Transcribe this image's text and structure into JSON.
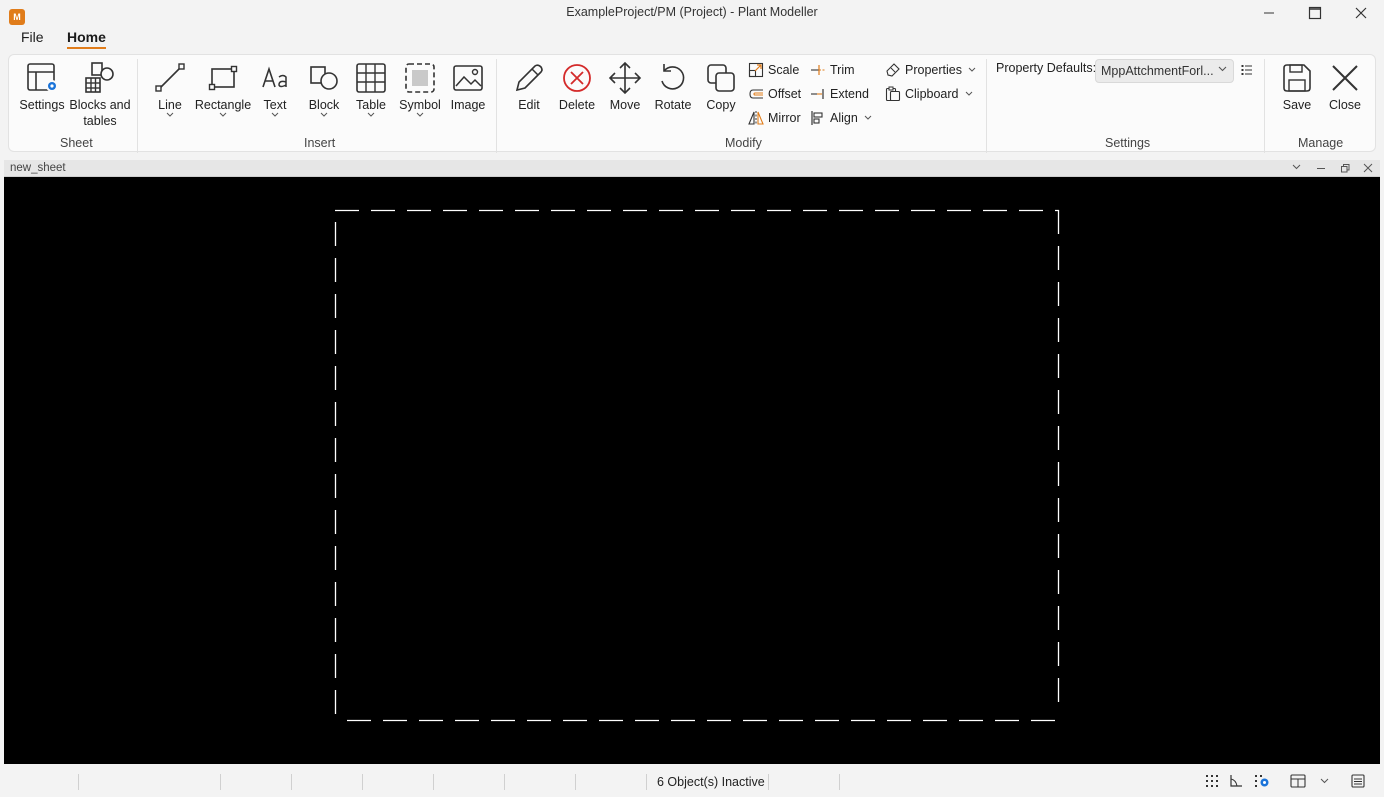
{
  "app": {
    "title": "ExampleProject/PM (Project) - Plant Modeller",
    "icon_letter": "M",
    "accent": "#e07c1a"
  },
  "menu": {
    "tabs": [
      {
        "label": "File",
        "active": false
      },
      {
        "label": "Home",
        "active": true
      }
    ]
  },
  "ribbon": {
    "sheet": {
      "group_label": "Sheet",
      "settings": "Settings",
      "blocks_line1": "Blocks and",
      "blocks_line2": "tables"
    },
    "insert": {
      "group_label": "Insert",
      "line": "Line",
      "rectangle": "Rectangle",
      "text": "Text",
      "block": "Block",
      "table": "Table",
      "symbol": "Symbol",
      "image": "Image"
    },
    "modify": {
      "group_label": "Modify",
      "edit": "Edit",
      "delete": "Delete",
      "move": "Move",
      "rotate": "Rotate",
      "copy": "Copy",
      "scale": "Scale",
      "offset": "Offset",
      "mirror": "Mirror",
      "trim": "Trim",
      "extend": "Extend",
      "align": "Align",
      "properties": "Properties",
      "clipboard": "Clipboard"
    },
    "settings": {
      "group_label": "Settings",
      "property_defaults_label": "Property Defaults:",
      "property_defaults_value": "MppAttchmentForl..."
    },
    "manage": {
      "group_label": "Manage",
      "save": "Save",
      "close": "Close"
    }
  },
  "document": {
    "tab_name": "new_sheet",
    "canvas_background": "#000000"
  },
  "status": {
    "text": "6 Object(s) Inactive"
  }
}
